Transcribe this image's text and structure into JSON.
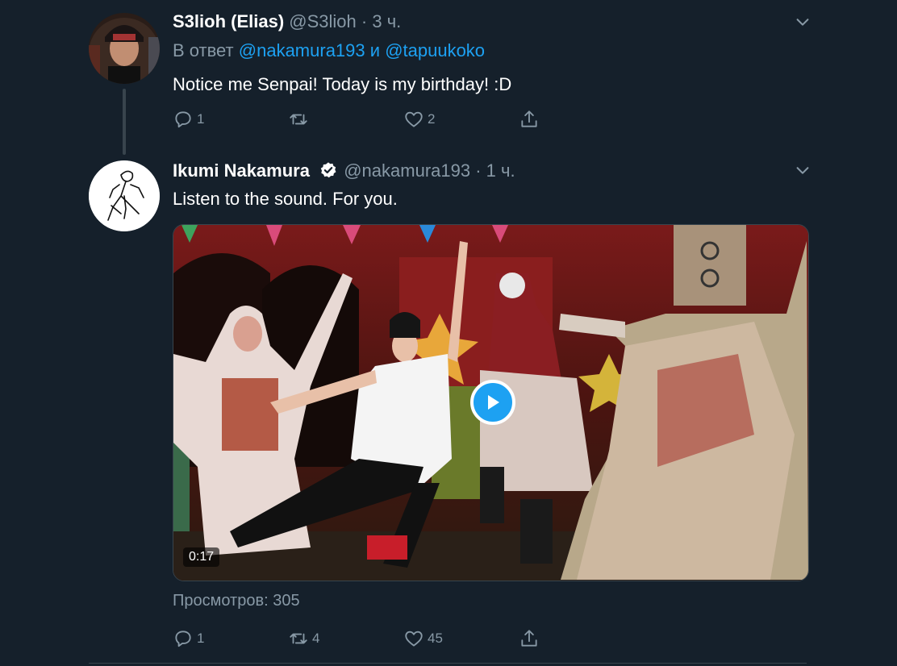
{
  "reply_tweet": {
    "author_name": "S3lioh (Elias)",
    "handle": "@S3lioh",
    "separator": "·",
    "time": "3 ч.",
    "reply_prefix": "В ответ",
    "reply_user_1": "@nakamura193",
    "reply_and": "и",
    "reply_user_2": "@tapuukoko",
    "text": "Notice me Senpai! Today is my birthday! :D",
    "reply_count": "1",
    "retweet_count": "",
    "like_count": "2"
  },
  "main_tweet": {
    "author_name": "Ikumi Nakamura",
    "handle": "@nakamura193",
    "separator": "·",
    "time": "1 ч.",
    "text": "Listen to the sound. For you.",
    "video_duration": "0:17",
    "views": "Просмотров: 305",
    "reply_count": "1",
    "retweet_count": "4",
    "like_count": "45"
  },
  "icons": {
    "reply": "reply-icon",
    "retweet": "retweet-icon",
    "like": "heart-icon",
    "share": "share-icon",
    "more": "chevron-down-icon",
    "verified": "verified-badge-icon",
    "play": "play-icon"
  },
  "colors": {
    "background": "#15202b",
    "accent": "#1da1f2",
    "secondary_text": "#8899a6",
    "divider": "#38444d"
  }
}
